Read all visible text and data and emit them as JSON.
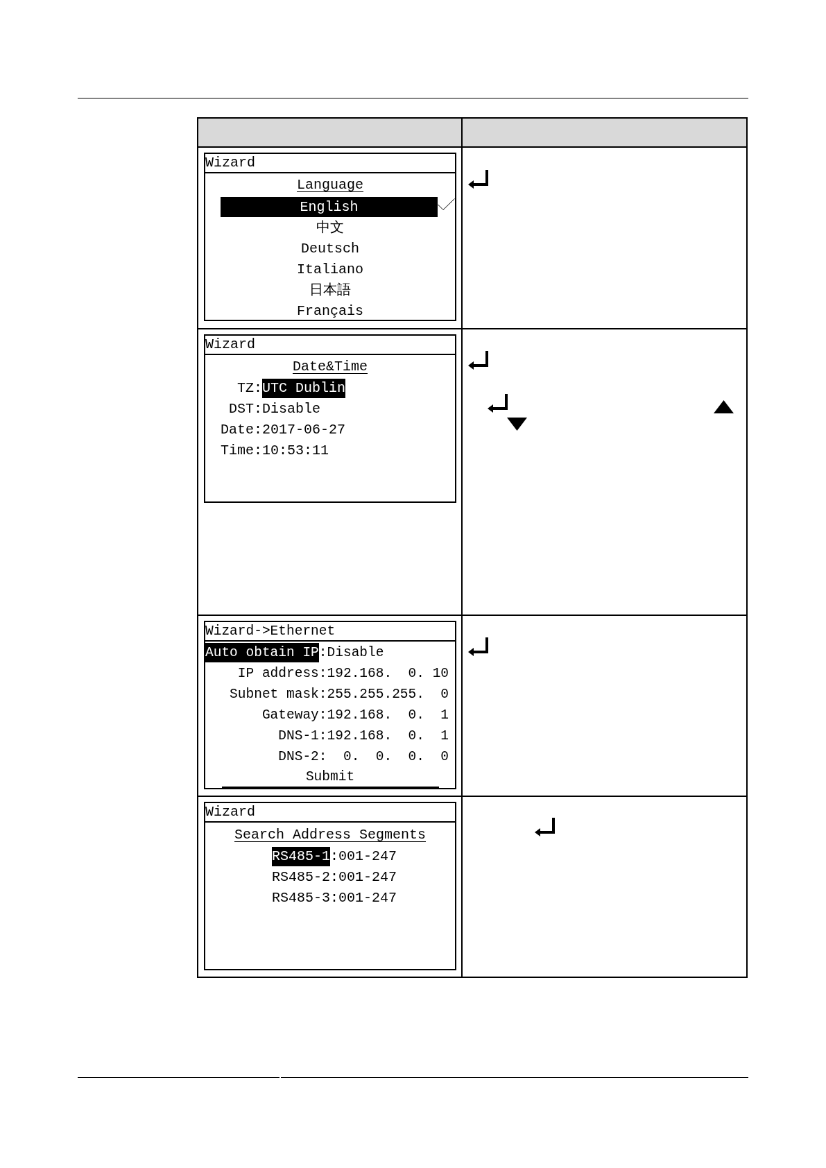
{
  "table": {
    "rows": [
      {
        "screen": {
          "kind": "list",
          "title": "Wizard",
          "heading": "Language",
          "items": [
            {
              "label": "English",
              "selected": true,
              "checked": true
            },
            {
              "label": "中文",
              "selected": false,
              "checked": false
            },
            {
              "label": "Deutsch",
              "selected": false,
              "checked": false
            },
            {
              "label": "Italiano",
              "selected": false,
              "checked": false
            },
            {
              "label": "日本語",
              "selected": false,
              "checked": false
            },
            {
              "label": "Français",
              "selected": false,
              "checked": false
            }
          ]
        },
        "key_lines": [
          [
            {
              "kind": "enter"
            }
          ]
        ]
      },
      {
        "screen": {
          "kind": "fields",
          "title": "Wizard",
          "heading": "Date&Time",
          "rows": [
            {
              "label": {
                "text": "TZ",
                "selected": false
              },
              "separator": ":",
              "value": {
                "text": "UTC Dublin",
                "selected": true
              }
            },
            {
              "label": {
                "text": "DST",
                "selected": false
              },
              "separator": ":",
              "value": {
                "text": "Disable",
                "selected": false
              }
            },
            {
              "label": {
                "text": "Date",
                "selected": false
              },
              "separator": ":",
              "value": {
                "text": "2017-06-27",
                "selected": false
              }
            },
            {
              "label": {
                "text": "Time",
                "selected": false
              },
              "separator": ":",
              "value": {
                "text": "10:53:11",
                "selected": false
              }
            }
          ]
        },
        "key_lines": [
          [
            {
              "kind": "enter"
            }
          ],
          [
            {
              "kind": "enter"
            },
            {
              "kind": "down"
            },
            {
              "kind": "up"
            }
          ]
        ]
      },
      {
        "screen": {
          "kind": "fields",
          "title": "Wizard->Ethernet",
          "rows": [
            {
              "label": {
                "text": "Auto obtain IP",
                "selected": true
              },
              "separator": ":",
              "value": {
                "text": "Disable",
                "selected": false
              }
            },
            {
              "label": {
                "text": "IP address",
                "selected": false
              },
              "separator": ":",
              "value": {
                "text": "192.168.  0. 10",
                "selected": false
              }
            },
            {
              "label": {
                "text": "Subnet mask",
                "selected": false
              },
              "separator": ":",
              "value": {
                "text": "255.255.255.  0",
                "selected": false
              }
            },
            {
              "label": {
                "text": "Gateway",
                "selected": false
              },
              "separator": ":",
              "value": {
                "text": "192.168.  0.  1",
                "selected": false
              }
            },
            {
              "label": {
                "text": "DNS-1",
                "selected": false
              },
              "separator": ":",
              "value": {
                "text": "192.168.  0.  1",
                "selected": false
              }
            },
            {
              "label": {
                "text": "DNS-2",
                "selected": false
              },
              "separator": ":",
              "value": {
                "text": "  0.  0.  0.  0",
                "selected": false
              }
            }
          ],
          "action": "Submit"
        },
        "key_lines": [
          [
            {
              "kind": "enter"
            }
          ]
        ]
      },
      {
        "screen": {
          "kind": "fields",
          "title": "Wizard",
          "heading": "Search Address Segments",
          "rows": [
            {
              "label": {
                "text": "RS485-1",
                "selected": true
              },
              "separator": ":",
              "value": {
                "text": "001-247",
                "selected": false
              }
            },
            {
              "label": {
                "text": "RS485-2",
                "selected": false
              },
              "separator": ":",
              "value": {
                "text": "001-247",
                "selected": false
              }
            },
            {
              "label": {
                "text": "RS485-3",
                "selected": false
              },
              "separator": ":",
              "value": {
                "text": "001-247",
                "selected": false
              }
            }
          ]
        },
        "key_lines": [
          [
            {
              "kind": "enter"
            }
          ]
        ]
      }
    ]
  }
}
